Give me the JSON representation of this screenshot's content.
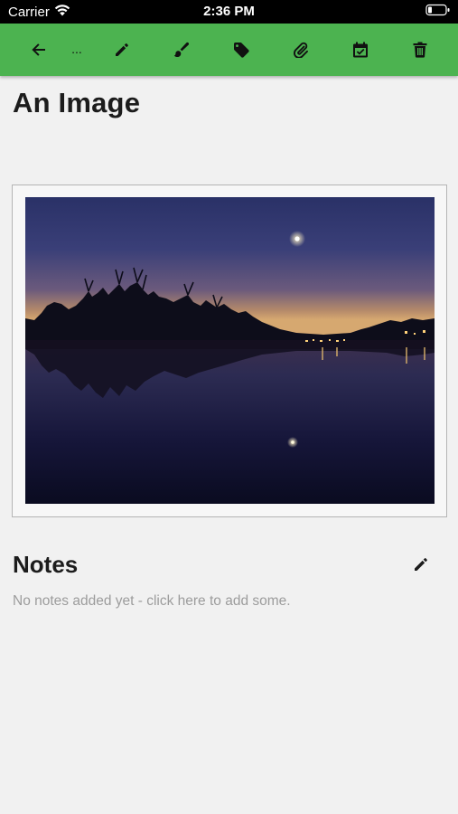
{
  "status_bar": {
    "carrier": "Carrier",
    "time": "2:36 PM",
    "icons": [
      "wifi-icon",
      "battery-icon"
    ]
  },
  "toolbar": {
    "background": "#4cb350",
    "ellipsis": "...",
    "buttons": [
      {
        "name": "back-button",
        "icon": "arrow-left-icon"
      },
      {
        "name": "edit-button",
        "icon": "pencil-icon"
      },
      {
        "name": "paint-button",
        "icon": "brush-icon"
      },
      {
        "name": "tag-button",
        "icon": "tag-icon"
      },
      {
        "name": "attach-button",
        "icon": "paperclip-icon"
      },
      {
        "name": "calendar-button",
        "icon": "calendar-check-icon"
      },
      {
        "name": "delete-button",
        "icon": "trash-icon"
      }
    ]
  },
  "page": {
    "title": "An Image"
  },
  "image": {
    "subject": "night lake with trees and moon reflection"
  },
  "notes": {
    "title": "Notes",
    "empty_text": "No notes added yet - click here to add some.",
    "edit_icon": "pencil-icon"
  }
}
